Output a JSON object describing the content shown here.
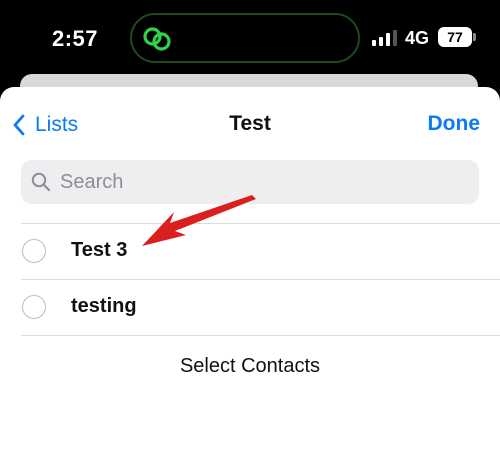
{
  "status_bar": {
    "time": "2:57",
    "network": "4G",
    "battery": "77",
    "icons": [
      "link-icon",
      "signal-icon"
    ]
  },
  "sheet": {
    "back_label": "Lists",
    "title": "Test",
    "done_label": "Done",
    "search": {
      "placeholder": "Search",
      "value": ""
    },
    "contacts": [
      {
        "label": "Test 3"
      },
      {
        "label": "testing"
      }
    ],
    "select_contacts_label": "Select Contacts"
  },
  "colors": {
    "accent": "#0a7bf5",
    "annotation_arrow": "#d9201f",
    "island_link": "#2fd24a"
  }
}
